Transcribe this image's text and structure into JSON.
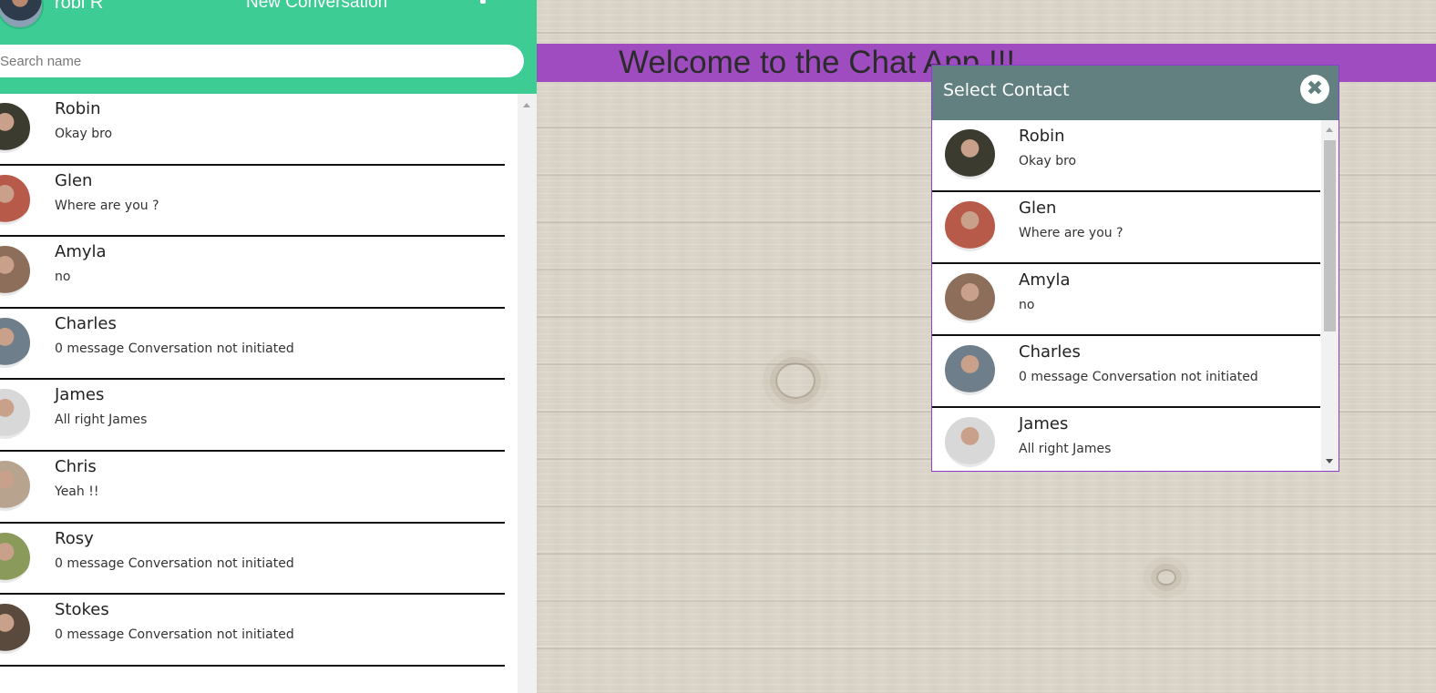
{
  "sidebar": {
    "user_name": "robi R",
    "new_conversation_label": "New Conversation",
    "search_placeholder": "Search name",
    "contacts": [
      {
        "name": "Robin",
        "message": "Okay bro",
        "avatar_color": "#3b3b2f"
      },
      {
        "name": "Glen",
        "message": "Where are you ?",
        "avatar_color": "#b85a4a"
      },
      {
        "name": "Amyla",
        "message": "no",
        "avatar_color": "#8d6e5a"
      },
      {
        "name": "Charles",
        "message": "0 message Conversation not initiated",
        "avatar_color": "#6e7e8a"
      },
      {
        "name": "James",
        "message": "All right James",
        "avatar_color": "#d8d8d8"
      },
      {
        "name": "Chris",
        "message": "Yeah !!",
        "avatar_color": "#b8a48e"
      },
      {
        "name": "Rosy",
        "message": "0 message Conversation not initiated",
        "avatar_color": "#8a9a5a"
      },
      {
        "name": "Stokes",
        "message": "0 message Conversation not initiated",
        "avatar_color": "#5a4a3e"
      }
    ]
  },
  "banner": {
    "text": "Welcome to the Chat App !!!"
  },
  "modal": {
    "title": "Select Contact",
    "close_glyph": "✖",
    "contacts": [
      {
        "name": "Robin",
        "message": "Okay bro",
        "avatar_color": "#3b3b2f"
      },
      {
        "name": "Glen",
        "message": "Where are you ?",
        "avatar_color": "#b85a4a"
      },
      {
        "name": "Amyla",
        "message": "no",
        "avatar_color": "#8d6e5a"
      },
      {
        "name": "Charles",
        "message": "0 message Conversation not initiated",
        "avatar_color": "#6e7e8a"
      },
      {
        "name": "James",
        "message": "All right James",
        "avatar_color": "#d8d8d8"
      }
    ]
  },
  "colors": {
    "topbar": "#3ccc94",
    "banner": "#9f4cc0",
    "modal_header": "#628080",
    "modal_border": "#8b3fcc"
  }
}
